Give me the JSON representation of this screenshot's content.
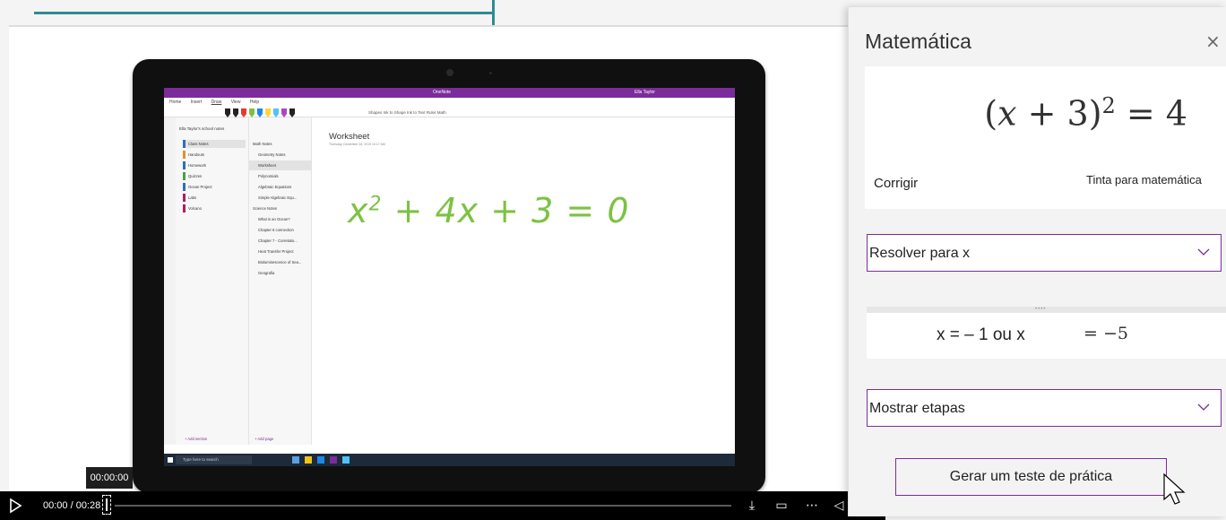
{
  "video": {
    "timecode_tooltip": "00:00:00",
    "time_display": "00:00 / 00:28",
    "progress": 0.0
  },
  "onenote": {
    "app_title": "OneNote",
    "user": "Ella Taylor",
    "ribbon_tabs": [
      "Home",
      "Insert",
      "Draw",
      "View",
      "Help"
    ],
    "ribbon_tools": "Shapes   Ink to Shape   Ink to Text   Ruler   Math",
    "notebook": "Ella Taylor's school notes",
    "sections": [
      {
        "label": "Class Notes",
        "color": "#2f6dbf",
        "active": true
      },
      {
        "label": "Handouts",
        "color": "#e6902c",
        "active": false
      },
      {
        "label": "Homework",
        "color": "#2f6dbf",
        "active": false
      },
      {
        "label": "Quizzes",
        "color": "#49a04a",
        "active": false
      },
      {
        "label": "Ocean Project",
        "color": "#2f6dbf",
        "active": false
      },
      {
        "label": "Labs",
        "color": "#b8195c",
        "active": false
      },
      {
        "label": "Volcano",
        "color": "#b8195c",
        "active": false
      }
    ],
    "pages": [
      {
        "label": "Math Notes",
        "head": true
      },
      {
        "label": "Geometry Notes"
      },
      {
        "label": "Worksheet",
        "active": true
      },
      {
        "label": "Polynomials"
      },
      {
        "label": "Algebraic Equations"
      },
      {
        "label": "Simple Algebraic Equ..."
      },
      {
        "label": "Science Notes",
        "head": true
      },
      {
        "label": "What is an Ocean?"
      },
      {
        "label": "Chapter 6 connection"
      },
      {
        "label": "Chapter 7 - Correlatio..."
      },
      {
        "label": "Heat Transfer Project"
      },
      {
        "label": "Bioluminescence of Sea..."
      },
      {
        "label": "Geografia"
      }
    ],
    "add_section": "+ Add section",
    "add_page": "+ Add page",
    "page_title": "Worksheet",
    "page_date": "Thursday, December 26, 2019      10:17 AM",
    "handwritten_equation": "x²+4x+3=0",
    "taskbar_search": "Type here to search"
  },
  "math_pane": {
    "title": "Matemática",
    "close_glyph": "×",
    "expression": "(x + 3)² = 4",
    "fix_label": "Corrigir",
    "ink_label": "Tinta para matemática",
    "action_dropdown": "Resolver para x",
    "solution_text": "x = – 1 ou x",
    "solution_value": "= −5",
    "steps_dropdown": "Mostrar etapas",
    "practice_button": "Gerar um teste de prática"
  },
  "colors": {
    "onenote_purple": "#7b2c9a",
    "ink_green": "#7cc242",
    "frame_teal": "#2e8b92"
  }
}
